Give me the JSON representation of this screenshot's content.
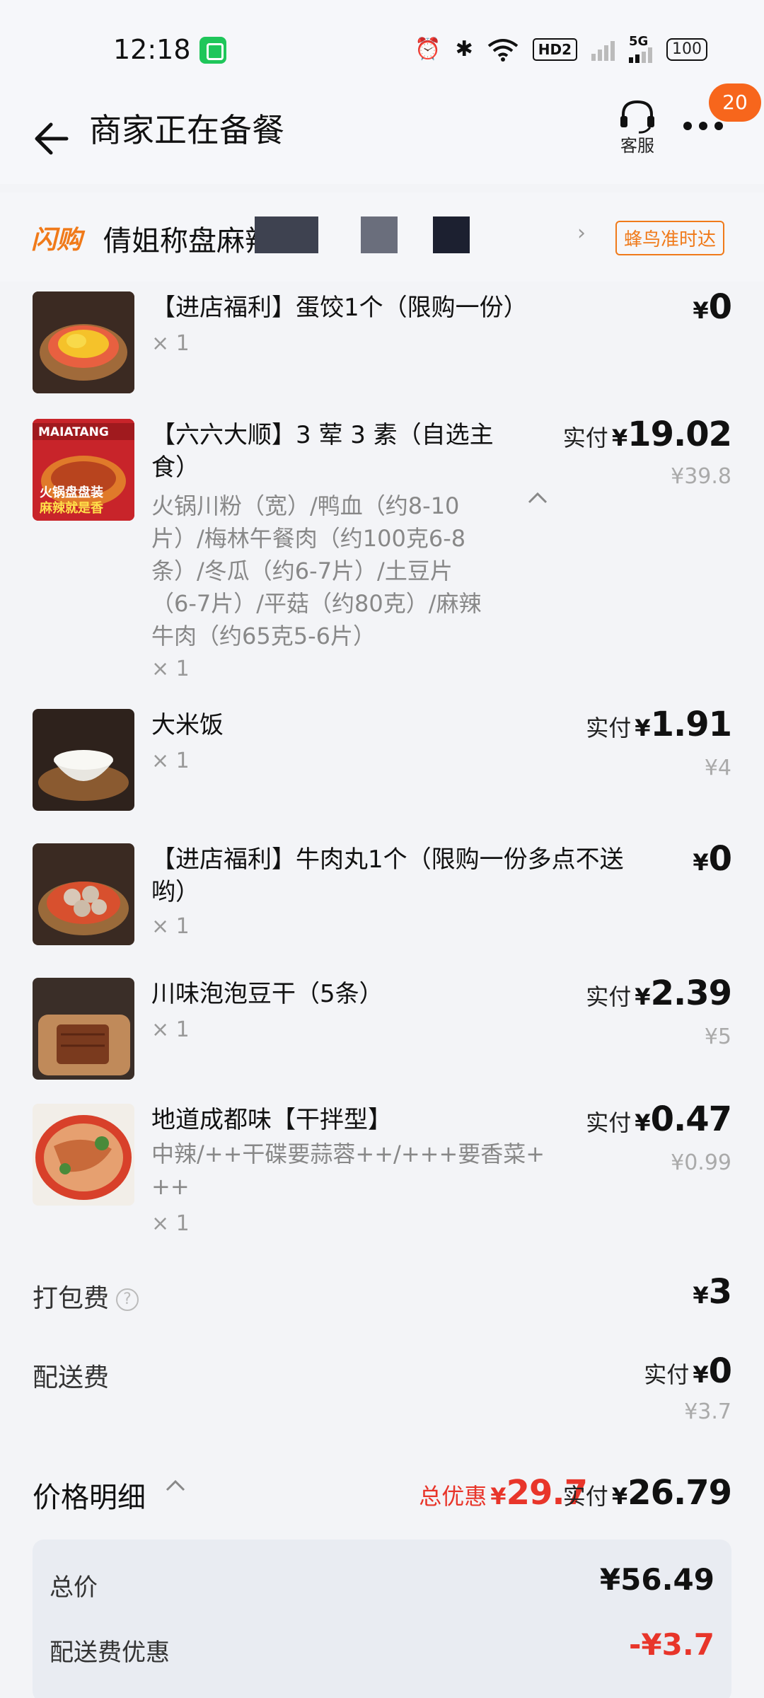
{
  "status_bar": {
    "time": "12:18",
    "hd_label": "HD2",
    "network_label": "5G",
    "battery": "100"
  },
  "header": {
    "title": "商家正在备餐",
    "service_label": "客服",
    "notification_count": "20"
  },
  "shop": {
    "logo_text": "闪购",
    "name": "倩姐称盘麻辣",
    "delivery_tag": "蜂鸟准时达"
  },
  "items": [
    {
      "title": "【进店福利】蛋饺1个（限购一份）",
      "qty": "× 1",
      "price_label": "",
      "currency": "¥",
      "price": "0",
      "original": ""
    },
    {
      "title_line1": "【六六大顺】3 荤 3 素（自选主",
      "title_line2": "食）",
      "spec_lines": [
        "火锅川粉（宽）/鸭血（约8-10",
        "片）/梅林午餐肉（约100克6-8",
        "条）/冬瓜（约6-7片）/土豆片",
        "（6-7片）/平菇（约80克）/麻辣",
        "牛肉（约65克5-6片）"
      ],
      "thumb_text_1": "MAIATANG",
      "thumb_text_2": "火锅盘盘装",
      "thumb_text_3": "麻辣就是香",
      "qty": "× 1",
      "price_label": "实付",
      "currency": "¥",
      "price": "19.02",
      "original": "¥39.8"
    },
    {
      "title": "大米饭",
      "qty": "× 1",
      "price_label": "实付",
      "currency": "¥",
      "price": "1.91",
      "original": "¥4"
    },
    {
      "title_line1": "【进店福利】牛肉丸1个（限购一份多点不送",
      "title_line2": "哟）",
      "qty": "× 1",
      "price_label": "",
      "currency": "¥",
      "price": "0",
      "original": ""
    },
    {
      "title": "川味泡泡豆干（5条）",
      "qty": "× 1",
      "price_label": "实付",
      "currency": "¥",
      "price": "2.39",
      "original": "¥5"
    },
    {
      "title": "地道成都味【干拌型】",
      "spec_lines": [
        "中辣/++干碟要蒜蓉++/+++要香菜+",
        "++"
      ],
      "qty": "× 1",
      "price_label": "实付",
      "currency": "¥",
      "price": "0.47",
      "original": "¥0.99"
    }
  ],
  "fees": {
    "packing_label": "打包费",
    "packing_help": "?",
    "packing_currency": "¥",
    "packing_value": "3",
    "delivery_label": "配送费",
    "delivery_price_label": "实付",
    "delivery_currency": "¥",
    "delivery_value": "0",
    "delivery_original": "¥3.7"
  },
  "price_detail": {
    "label": "价格明细",
    "discount_label": "总优惠",
    "discount_currency": "¥",
    "discount_value": "29.7",
    "final_label": "实付",
    "final_currency": "¥",
    "final_value": "26.79"
  },
  "summary": {
    "total_label": "总价",
    "total_value": "¥56.49",
    "delivery_discount_label": "配送费优惠",
    "delivery_discount_value": "-¥3.7"
  },
  "colors": {
    "accent_orange": "#f07a1a",
    "discount_red": "#e8352a",
    "badge_orange": "#f7661c"
  }
}
